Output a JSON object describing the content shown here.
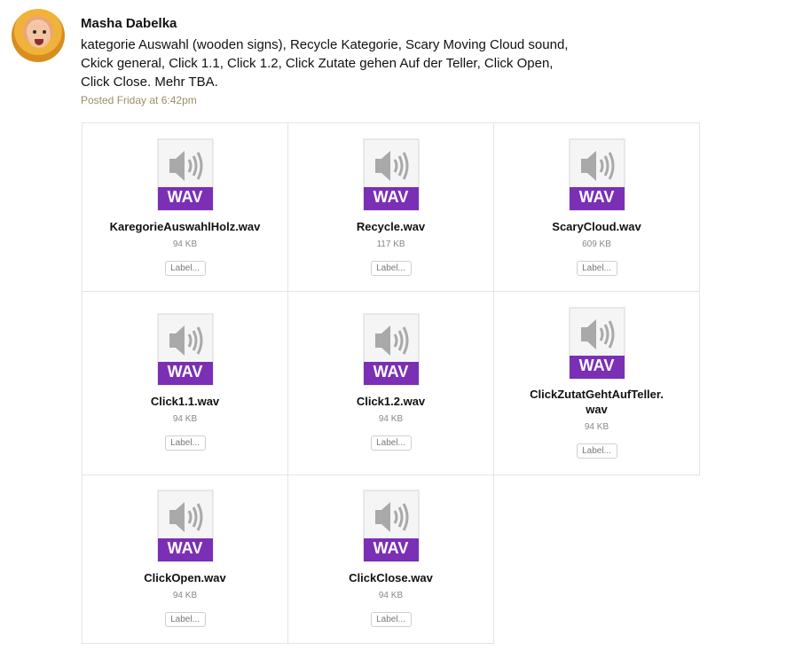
{
  "post": {
    "author": "Masha Dabelka",
    "message": " kategorie Auswahl (wooden signs), Recycle Kategorie, Scary Moving Cloud sound,\nCkick general, Click 1.1, Click 1.2, Click Zutate gehen Auf der Teller, Click Open,\nClick Close. Mehr TBA.",
    "timestamp": "Posted Friday at 6:42pm"
  },
  "attachments": [
    {
      "name": "KaregorieAuswahlHolz.wav",
      "size": "94 KB",
      "badge": "WAV",
      "label_button": "Label..."
    },
    {
      "name": "Recycle.wav",
      "size": "117 KB",
      "badge": "WAV",
      "label_button": "Label..."
    },
    {
      "name": "ScaryCloud.wav",
      "size": "609 KB",
      "badge": "WAV",
      "label_button": "Label..."
    },
    {
      "name": "Click1.1.wav",
      "size": "94 KB",
      "badge": "WAV",
      "label_button": "Label..."
    },
    {
      "name": "Click1.2.wav",
      "size": "94 KB",
      "badge": "WAV",
      "label_button": "Label..."
    },
    {
      "name": "ClickZutatGehtAufTeller.\nwav",
      "size": "94 KB",
      "badge": "WAV",
      "label_button": "Label..."
    },
    {
      "name": "ClickOpen.wav",
      "size": "94 KB",
      "badge": "WAV",
      "label_button": "Label..."
    },
    {
      "name": "ClickClose.wav",
      "size": "94 KB",
      "badge": "WAV",
      "label_button": "Label..."
    }
  ],
  "icons": {
    "avatar": "user-avatar",
    "file": "audio-file-icon"
  },
  "colors": {
    "badge_purple": "#7b2fb5",
    "timestamp": "#a08b66"
  }
}
